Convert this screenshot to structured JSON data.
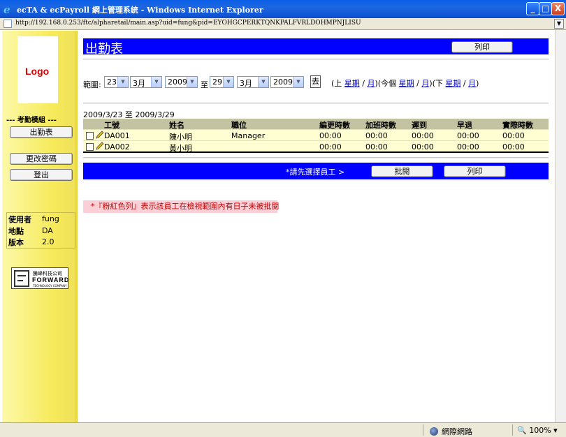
{
  "window": {
    "title": "ecTA & ecPayroll 網上管理系統 - Windows Internet Explorer",
    "minimize": "_",
    "maximize": "□",
    "close": "X"
  },
  "address": {
    "url": "http://192.168.0.253/ftc/alpharetail/main.asp?uid=fung&pid=EYOHGCPERKTQNKPALFVRLDOHMPNJLISU"
  },
  "sidebar": {
    "logo": "Logo",
    "module_title": "--- 考勤模組 ---",
    "buttons": [
      "出勤表",
      "更改密碼",
      "登出"
    ],
    "user_info": [
      {
        "key": "使用者",
        "value": "fung"
      },
      {
        "key": "地點",
        "value": "DA"
      },
      {
        "key": "版本",
        "value": "2.0"
      }
    ],
    "company": {
      "cn": "騰峰科技公司",
      "en": "FORWARD",
      "sub": "TECHNOLOGY COMPANY"
    }
  },
  "main": {
    "page_title": "出勤表",
    "print_label": "列印",
    "range": {
      "label": "範圍:",
      "from_day": "23",
      "from_month": "3月",
      "from_year": "2009",
      "to": "至",
      "to_day": "29",
      "to_month": "3月",
      "to_year": "2009",
      "go": "去"
    },
    "nav": {
      "prev_open": "(上",
      "week": "星期",
      "slash": "/",
      "month": "月",
      "this_open": ")(今個",
      "next_open": ")(下",
      "close": ")"
    },
    "period": "2009/3/23 至 2009/3/29",
    "table": {
      "headers": [
        "工號",
        "姓名",
        "職位",
        "編更時數",
        "加班時數",
        "遲到",
        "早退",
        "實際時數"
      ],
      "rows": [
        {
          "id": "DA001",
          "name": "陳小明",
          "position": "Manager",
          "shift": "00:00",
          "ot": "00:00",
          "late": "00:00",
          "early": "00:00",
          "actual": "00:00"
        },
        {
          "id": "DA002",
          "name": "黃小明",
          "position": "",
          "shift": "00:00",
          "ot": "00:00",
          "late": "00:00",
          "early": "00:00",
          "actual": "00:00"
        }
      ]
    },
    "hint": "*請先選擇員工 >",
    "approve_label": "批閱",
    "note": "*『粉紅色列』表示該員工在檢視範圍內有日子未被批閱"
  },
  "status": {
    "zone": "網際網路",
    "zoom": "100%"
  },
  "colors": {
    "title_bar": "#0000ff",
    "sidebar": "#f6ea5a",
    "row_bg": "#fefed2",
    "header_bg": "#c3c3a2",
    "note_bg": "#fbcfd6",
    "note_text": "#c00000"
  }
}
